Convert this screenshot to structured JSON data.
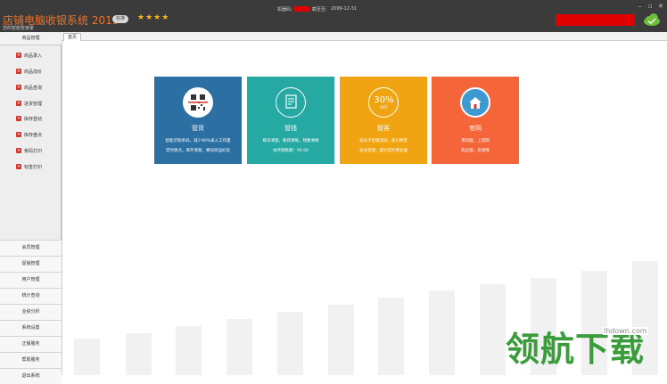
{
  "titlebar": {
    "app_title": "店铺电脑收银系统 2019",
    "version_badge": "标准",
    "stars": "★★★★",
    "subtitle": "您的智能管家家",
    "machine_code_label": "机器码:",
    "expire_label": "截至至:",
    "expire_date": "2099-12-31",
    "window_buttons": {
      "minimize": "–",
      "maximize": "▫",
      "close": "✕"
    }
  },
  "sidebar": {
    "header": "商品管理",
    "items": [
      {
        "label": "商品录入"
      },
      {
        "label": "商品加价"
      },
      {
        "label": "商品查询"
      },
      {
        "label": "进货管理"
      },
      {
        "label": "库存登动"
      },
      {
        "label": "库存盘点"
      },
      {
        "label": "条码打印"
      },
      {
        "label": "标签打印"
      }
    ],
    "nav": [
      {
        "label": "会员管理"
      },
      {
        "label": "促销管理"
      },
      {
        "label": "用户管理"
      },
      {
        "label": "统计查询"
      },
      {
        "label": "业绩分析"
      },
      {
        "label": "系统设置"
      },
      {
        "label": "正版服务"
      },
      {
        "label": "帮助服务"
      },
      {
        "label": "退出系统"
      }
    ]
  },
  "tabs": [
    {
      "label": "首页"
    }
  ],
  "cards": [
    {
      "title": "管货",
      "line1": "智能识别条码，减少90%录入工作量",
      "line2": "定时盘点，库存清楚，哪块商品好卖",
      "color": "#2b6fa3",
      "icon": "barcode-scan-icon"
    },
    {
      "title": "管钱",
      "line1": "每日清楚，账目清晰，钱数清晰",
      "line2": "本月销售额：¥0.00",
      "color": "#26a9a3",
      "icon": "document-edit-icon"
    },
    {
      "title": "管客",
      "line1": "会员卡促销活动，吸引顾客",
      "line2": "会员管理，是好提升营业额",
      "color": "#f0a411",
      "icon": "discount-30-off-icon"
    },
    {
      "title": "官网",
      "line1": "用问题，上官网",
      "line2": "购正版，有保障",
      "color": "#f4663a",
      "icon": "home-icon"
    }
  ],
  "watermark": {
    "url": "lhdown.com",
    "logo_text": "领航下载"
  }
}
